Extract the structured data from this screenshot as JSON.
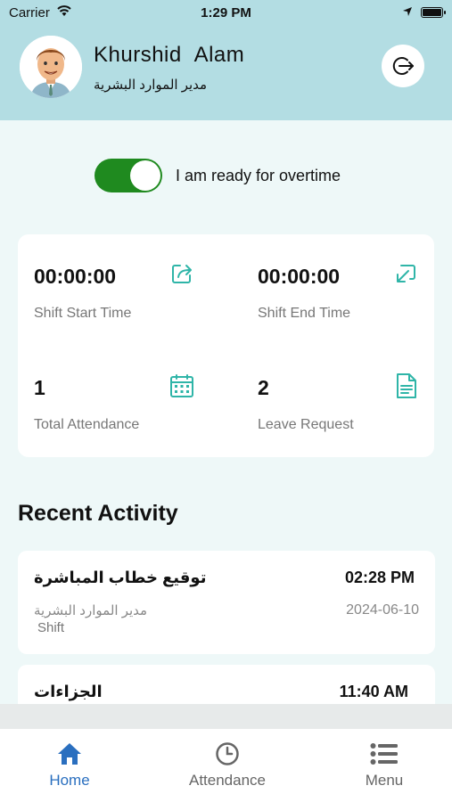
{
  "status_bar": {
    "carrier": "Carrier",
    "time": "1:29 PM"
  },
  "header": {
    "name": "Khurshid  Alam",
    "role": "مدير الموارد البشرية"
  },
  "overtime": {
    "label": "I am ready for overtime",
    "enabled": true
  },
  "stats": {
    "shift_start": {
      "value": "00:00:00",
      "label": "Shift Start Time",
      "icon": "share-icon"
    },
    "shift_end": {
      "value": "00:00:00",
      "label": "Shift End Time",
      "icon": "exchange-icon"
    },
    "total_attendance": {
      "value": "1",
      "label": "Total Attendance",
      "icon": "calendar-icon"
    },
    "leave_request": {
      "value": "2",
      "label": "Leave Request",
      "icon": "document-icon"
    }
  },
  "recent_activity": {
    "title": "Recent Activity",
    "items": [
      {
        "title": "توقيع خطاب المباشرة",
        "time": "02:28 PM",
        "subtitle": "مدير الموارد البشرية",
        "type": "Shift",
        "date": "2024-06-10"
      },
      {
        "title": "الجزاءات",
        "time": "11:40 AM"
      }
    ]
  },
  "tabs": [
    {
      "label": "Home",
      "icon": "home-icon",
      "active": true
    },
    {
      "label": "Attendance",
      "icon": "clock-icon",
      "active": false
    },
    {
      "label": "Menu",
      "icon": "list-icon",
      "active": false
    }
  ],
  "colors": {
    "header_bg": "#b3dde3",
    "page_bg": "#eef8f8",
    "toggle_on": "#1f8a1f",
    "icon_teal": "#2fb5a8",
    "tab_active": "#2a6fbf"
  }
}
